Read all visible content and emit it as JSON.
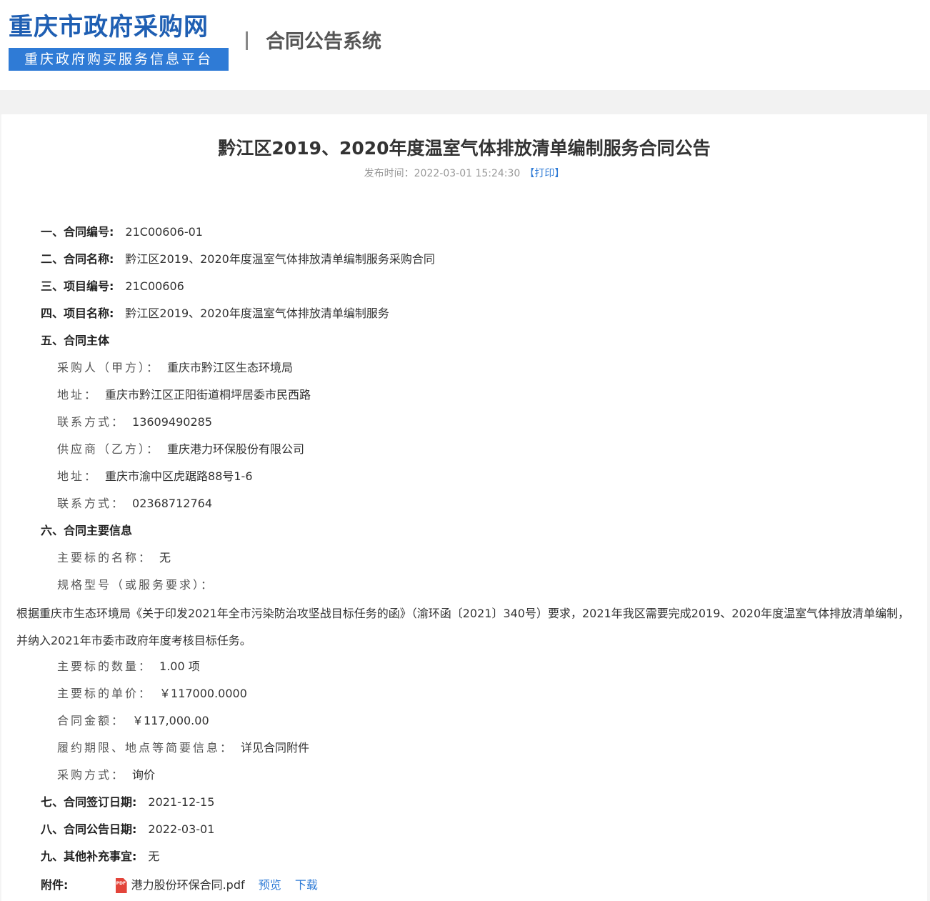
{
  "header": {
    "site_title": "重庆市政府采购网",
    "site_subtitle": "重庆政府购买服务信息平台",
    "divider": "|",
    "system_title": "合同公告系统"
  },
  "notice": {
    "title": "黔江区2019、2020年度温室气体排放清单编制服务合同公告",
    "publish_label": "发布时间：",
    "publish_time": "2022-03-01 15:24:30",
    "print_label": "【打印】"
  },
  "sections": {
    "s1": {
      "label": "一、合同编号:",
      "value": "21C00606-01"
    },
    "s2": {
      "label": "二、合同名称:",
      "value": "黔江区2019、2020年度温室气体排放清单编制服务采购合同"
    },
    "s3": {
      "label": "三、项目编号:",
      "value": "21C00606"
    },
    "s4": {
      "label": "四、项目名称:",
      "value": "黔江区2019、2020年度温室气体排放清单编制服务"
    },
    "s5": {
      "label": "五、合同主体"
    },
    "buyer": {
      "label": "采购人（甲方）：",
      "value": "重庆市黔江区生态环境局"
    },
    "buyer_address": {
      "label": "地址：",
      "value": "重庆市黔江区正阳街道桐坪居委市民西路"
    },
    "buyer_phone": {
      "label": "联系方式：",
      "value": "13609490285"
    },
    "supplier": {
      "label": "供应商（乙方）：",
      "value": "重庆港力环保股份有限公司"
    },
    "supplier_address": {
      "label": "地址：",
      "value": "重庆市渝中区虎踞路88号1-6"
    },
    "supplier_phone": {
      "label": "联系方式：",
      "value": "02368712764"
    },
    "s6": {
      "label": "六、合同主要信息"
    },
    "subject_name": {
      "label": "主要标的名称：",
      "value": "无"
    },
    "spec": {
      "label": "规格型号（或服务要求）："
    },
    "spec_text": "根据重庆市生态环境局《关于印发2021年全市污染防治攻坚战目标任务的函》（渝环函〔2021〕340号）要求，2021年我区需要完成2019、2020年度温室气体排放清单编制，并纳入2021年市委市政府年度考核目标任务。",
    "quantity": {
      "label": "主要标的数量：",
      "value": "1.00 项"
    },
    "unit_price": {
      "label": "主要标的单价：",
      "value": "￥117000.0000"
    },
    "amount": {
      "label": "合同金额：",
      "value": "￥117,000.00"
    },
    "term": {
      "label": "履约期限、地点等简要信息：",
      "value": "详见合同附件"
    },
    "method": {
      "label": "采购方式：",
      "value": "询价"
    },
    "s7": {
      "label": "七、合同签订日期:",
      "value": "2021-12-15"
    },
    "s8": {
      "label": "八、合同公告日期:",
      "value": "2022-03-01"
    },
    "s9": {
      "label": "九、其他补充事宜:",
      "value": "无"
    }
  },
  "attachment": {
    "label": "附件:",
    "icon": "pdf-icon",
    "icon_text": "PDF",
    "file_name": "港力股份环保合同.pdf",
    "preview": "预览",
    "download": "下载"
  },
  "colors": {
    "brand_blue": "#1f5fb3",
    "link_blue": "#2f7bd6",
    "pdf_red": "#e3443a"
  }
}
